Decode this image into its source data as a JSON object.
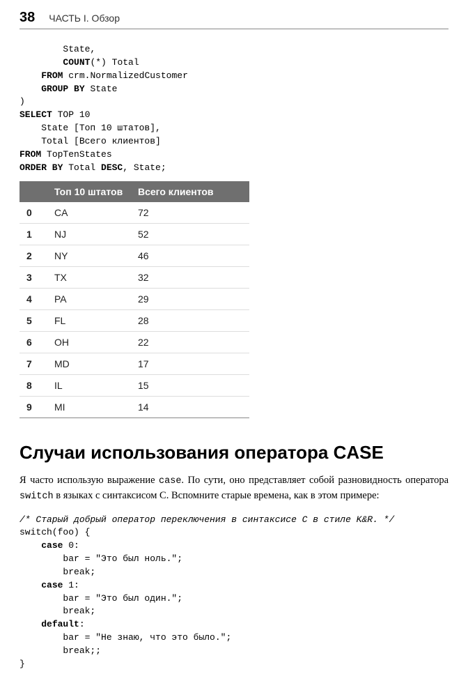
{
  "header": {
    "page_number": "38",
    "section_title": "ЧАСТЬ I. Обзор"
  },
  "sql_code": {
    "l1": "        State,",
    "l2a": "        ",
    "l2b": "COUNT",
    "l2c": "(*) Total",
    "l3a": "    ",
    "l3b": "FROM",
    "l3c": " crm.NormalizedCustomer",
    "l4a": "    ",
    "l4b": "GROUP BY",
    "l4c": " State",
    "l5": ")",
    "l6a": "SELECT",
    "l6b": " TOP 10",
    "l7": "    State [Топ 10 штатов],",
    "l8": "    Total [Всего клиентов]",
    "l9a": "FROM",
    "l9b": " TopTenStates",
    "l10a": "ORDER BY",
    "l10b": " Total ",
    "l10c": "DESC",
    "l10d": ", State;"
  },
  "chart_data": {
    "type": "table",
    "columns": [
      "",
      "Топ 10 штатов",
      "Всего клиентов"
    ],
    "rows": [
      {
        "idx": "0",
        "state": "CA",
        "total": "72"
      },
      {
        "idx": "1",
        "state": "NJ",
        "total": "52"
      },
      {
        "idx": "2",
        "state": "NY",
        "total": "46"
      },
      {
        "idx": "3",
        "state": "TX",
        "total": "32"
      },
      {
        "idx": "4",
        "state": "PA",
        "total": "29"
      },
      {
        "idx": "5",
        "state": "FL",
        "total": "28"
      },
      {
        "idx": "6",
        "state": "OH",
        "total": "22"
      },
      {
        "idx": "7",
        "state": "MD",
        "total": "17"
      },
      {
        "idx": "8",
        "state": "IL",
        "total": "15"
      },
      {
        "idx": "9",
        "state": "MI",
        "total": "14"
      }
    ]
  },
  "heading": "Случаи использования оператора CASE",
  "paragraph": {
    "p1a": "Я часто использую выражение ",
    "p1b": "case",
    "p1c": ". По сути, оно представляет собой разновид­ность оператора ",
    "p1d": "switch",
    "p1e": " в языках с синтаксисом С. Вспомните старые времена, как в этом примере:"
  },
  "c_code": {
    "l1": "/* Старый добрый оператор переключения в синтаксисе С в стиле K&R. */",
    "l2": "switch(foo) {",
    "l3a": "    ",
    "l3b": "case",
    "l3c": " 0:",
    "l4": "        bar = \"Это был ноль.\";",
    "l5": "        break;",
    "l6a": "    ",
    "l6b": "case",
    "l6c": " 1:",
    "l7": "        bar = \"Это был один.\";",
    "l8": "        break;",
    "l9a": "    ",
    "l9b": "default",
    "l9c": ":",
    "l10": "        bar = \"Не знаю, что это было.\";",
    "l11": "        break;;",
    "l12": "}"
  }
}
